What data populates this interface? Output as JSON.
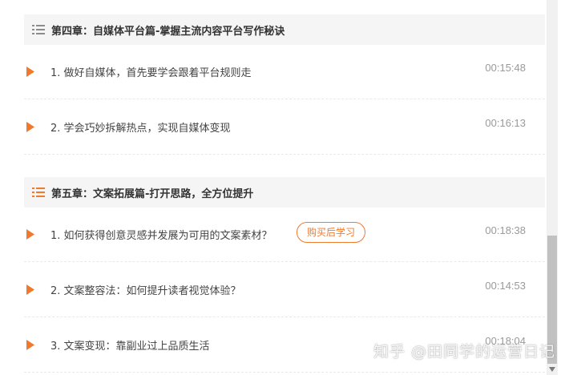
{
  "colors": {
    "accent": "#f07a2b",
    "chapter_bg": "#f5f5f5",
    "divider": "#e9e9e9"
  },
  "chapters": [
    {
      "title": "第四章：自媒体平台篇-掌握主流内容平台写作秘诀",
      "icon": "list-icon",
      "lessons": [
        {
          "title": "1. 做好自媒体，首先要学会跟着平台规则走",
          "duration": "00:15:48",
          "icon": "play-icon"
        },
        {
          "title": "2. 学会巧妙拆解热点，实现自媒体变现",
          "duration": "00:16:13",
          "icon": "play-icon"
        }
      ]
    },
    {
      "title": "第五章：文案拓展篇-打开思路，全方位提升",
      "icon": "list-icon",
      "lessons": [
        {
          "title": "1. 如何获得创意灵感并发展为可用的文案素材？",
          "duration": "00:18:38",
          "icon": "play-icon",
          "badge": "购买后学习"
        },
        {
          "title": "2. 文案整容法：如何提升读者视觉体验？",
          "duration": "00:14:53",
          "icon": "play-icon"
        },
        {
          "title": "3. 文案变现：靠副业过上品质生活",
          "duration": "00:18:04",
          "icon": "play-icon"
        }
      ]
    }
  ],
  "watermark": "知乎 @田同学的运营日记"
}
